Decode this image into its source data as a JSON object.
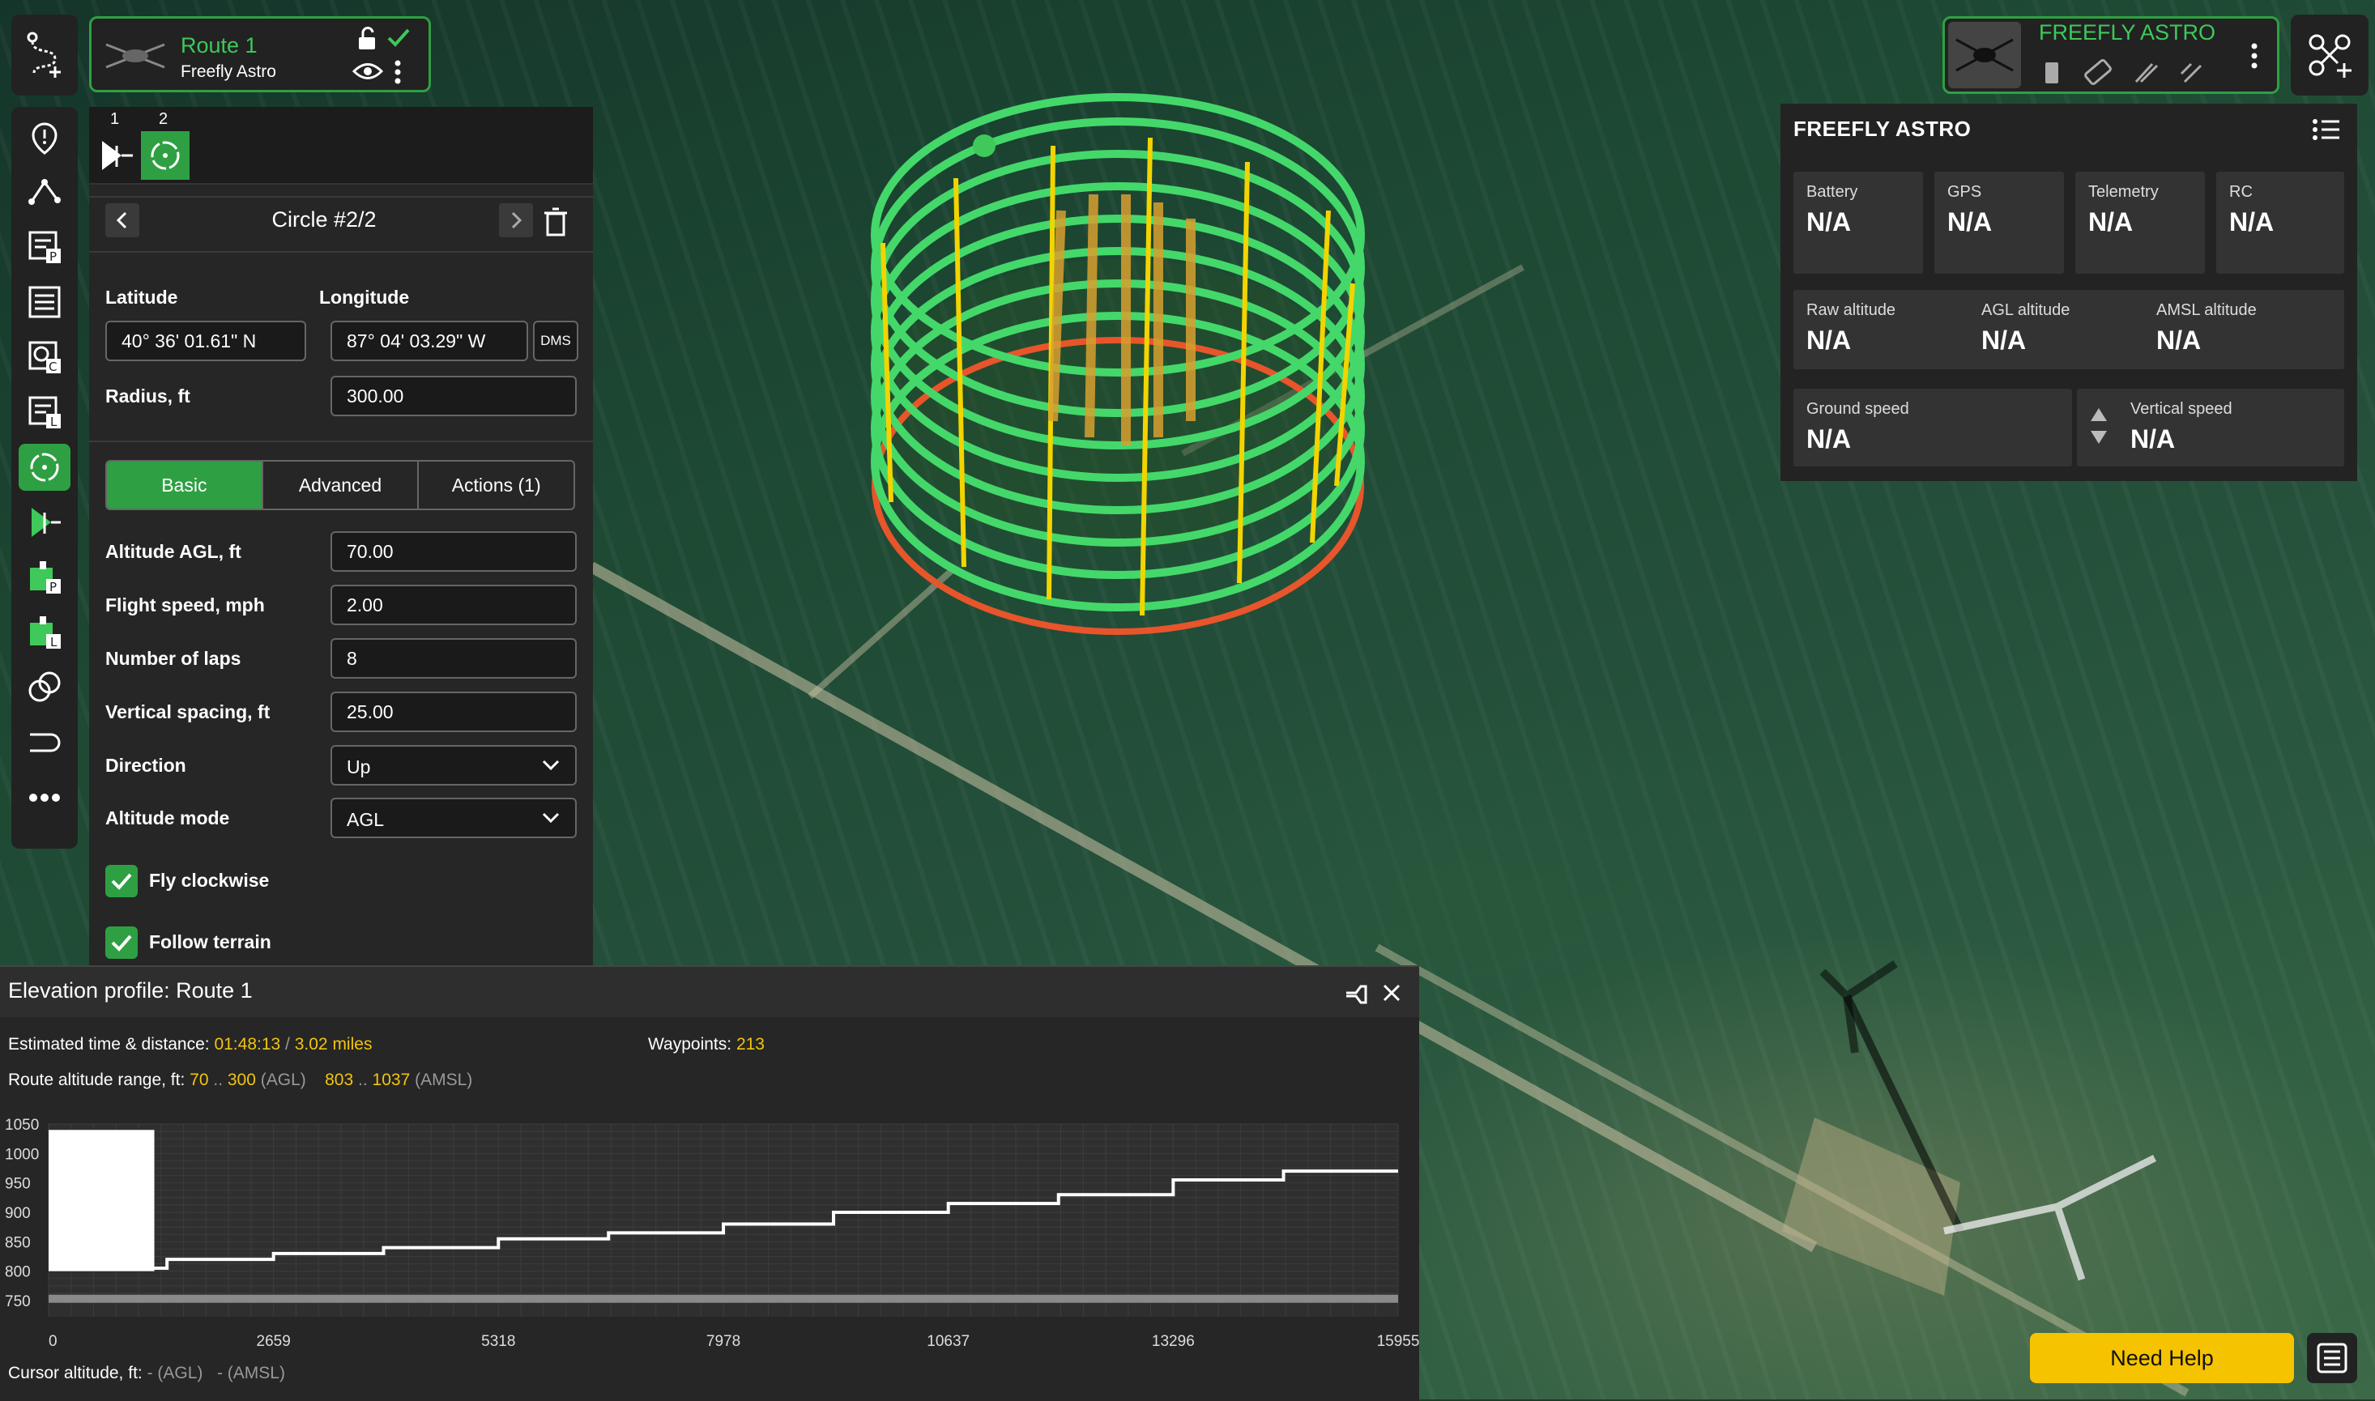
{
  "route": {
    "name": "Route 1",
    "subtitle": "Freefly Astro"
  },
  "segments": [
    {
      "num": "1"
    },
    {
      "num": "2"
    }
  ],
  "editor": {
    "title": "Circle #2/2",
    "latitude_label": "Latitude",
    "longitude_label": "Longitude",
    "latitude": "40° 36' 01.61\" N",
    "longitude": "87° 04' 03.29\" W",
    "dms_label": "DMS",
    "radius_label": "Radius, ft",
    "radius": "300.00",
    "tabs": [
      {
        "label": "Basic"
      },
      {
        "label": "Advanced"
      },
      {
        "label": "Actions (1)"
      }
    ],
    "fields": [
      {
        "label": "Altitude AGL, ft",
        "value": "70.00"
      },
      {
        "label": "Flight speed, mph",
        "value": "2.00"
      },
      {
        "label": "Number of laps",
        "value": "8"
      },
      {
        "label": "Vertical spacing, ft",
        "value": "25.00"
      },
      {
        "label": "Direction",
        "value": "Up"
      },
      {
        "label": "Altitude mode",
        "value": "AGL"
      }
    ],
    "checkboxes": [
      {
        "label": "Fly clockwise"
      },
      {
        "label": "Follow terrain"
      }
    ]
  },
  "drone": {
    "name": "FREEFLY ASTRO"
  },
  "telemetry": {
    "title": "FREEFLY ASTRO",
    "row1": [
      {
        "key": "Battery",
        "value": "N/A"
      },
      {
        "key": "GPS",
        "value": "N/A"
      },
      {
        "key": "Telemetry",
        "value": "N/A"
      },
      {
        "key": "RC",
        "value": "N/A"
      }
    ],
    "row2": [
      {
        "key": "Raw altitude",
        "value": "N/A"
      },
      {
        "key": "AGL altitude",
        "value": "N/A"
      },
      {
        "key": "AMSL altitude",
        "value": "N/A"
      }
    ],
    "row3": [
      {
        "key": "Ground speed",
        "value": "N/A"
      },
      {
        "key": "Vertical speed",
        "value": "N/A"
      }
    ]
  },
  "elevation": {
    "title": "Elevation profile: Route 1",
    "time_label": "Estimated time & distance:",
    "time": "01:48:13",
    "slash": "/",
    "distance": "3.02 miles",
    "waypoints_label": "Waypoints:",
    "waypoints": "213",
    "range_label": "Route altitude range, ft:",
    "agl_min": "70",
    "dots": "..",
    "agl_max": "300",
    "agl_tag": "(AGL)",
    "amsl_min": "803",
    "amsl_max": "1037",
    "amsl_tag": "(AMSL)",
    "cursor_label": "Cursor altitude, ft:",
    "cursor_agl": "- (AGL)",
    "cursor_amsl": "- (AMSL)"
  },
  "chart_data": {
    "type": "line",
    "xlabel": "",
    "ylabel": "",
    "xlim": [
      0,
      15955
    ],
    "ylim": [
      750,
      1050
    ],
    "x_ticks": [
      "0",
      "2659",
      "5318",
      "7978",
      "10637",
      "13296",
      "15955"
    ],
    "y_ticks": [
      "1050",
      "1000",
      "950",
      "900",
      "850",
      "800",
      "750"
    ],
    "series": [
      {
        "x": [
          0,
          1400,
          1400,
          2659,
          2659,
          3960,
          3960,
          5318,
          5318,
          6620,
          6620,
          7978,
          7978,
          9280,
          9280,
          10637,
          10637,
          11940,
          11940,
          13296,
          13296,
          14600,
          14600,
          15955
        ],
        "y": [
          805,
          805,
          820,
          820,
          830,
          830,
          840,
          840,
          855,
          855,
          865,
          865,
          880,
          880,
          900,
          900,
          915,
          915,
          930,
          930,
          955,
          955,
          970,
          970
        ]
      }
    ],
    "spike_region": {
      "x": [
        0,
        1250
      ],
      "y": [
        800,
        1040
      ]
    },
    "terrain": {
      "y": 760
    }
  },
  "help": {
    "label": "Need Help"
  }
}
